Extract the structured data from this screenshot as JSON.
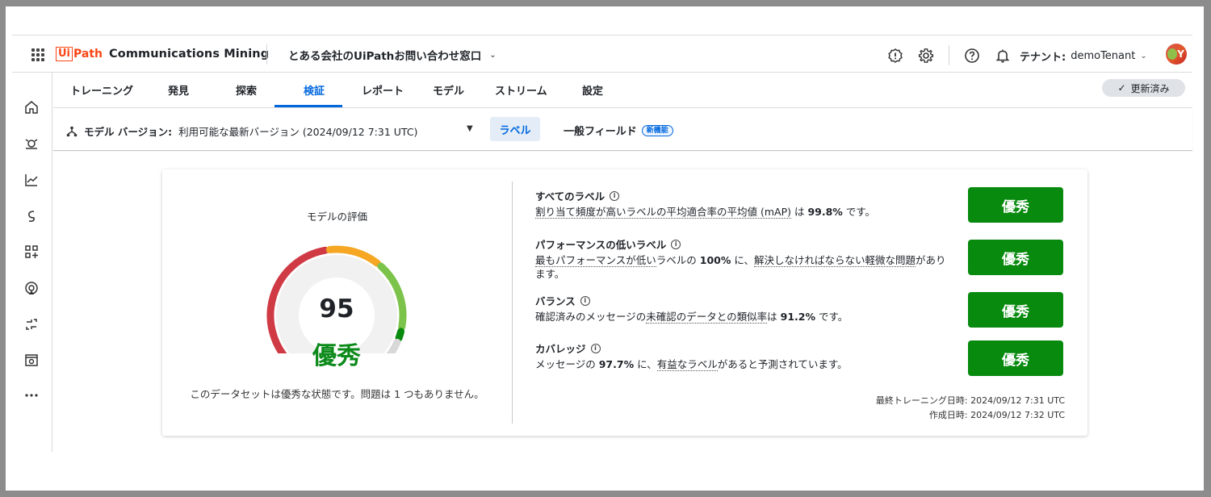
{
  "header": {
    "logo_ui": "Ui",
    "logo_path": "Path",
    "product": "Communications Mining",
    "project": "とある会社のUiPathお問い合わせ窓口",
    "tenant_label": "テナント:",
    "tenant_value": "demoTenant",
    "avatar_initial": "Y",
    "icons": [
      "apps-grid-icon",
      "alert-icon",
      "gear-icon",
      "help-icon",
      "bell-icon"
    ]
  },
  "tabs": [
    "トレーニング",
    "発見",
    "探索",
    "検証",
    "レポート",
    "モデル",
    "ストリーム",
    "設定"
  ],
  "active_tab": "検証",
  "refresh_label": "更新済み",
  "subbar": {
    "model_version_label": "モデル バージョン:",
    "model_version_value": "利用可能な最新バージョン (2024/09/12 7:31 UTC)",
    "labels_tab": "ラベル",
    "general_fields_tab": "一般フィールド",
    "new_badge": "新機能"
  },
  "rail_icons": [
    "home-icon",
    "discover-icon",
    "chart-icon",
    "stream-icon",
    "apps-add-icon",
    "signal-icon",
    "integration-icon",
    "building-icon",
    "more-icon"
  ],
  "rating": {
    "title": "モデルの評価",
    "score": "95",
    "score_value": 95,
    "grade": "優秀",
    "summary": "このデータセットは優秀な状態です。問題は 1 つもありません。",
    "colors": {
      "poor": "#d03a45",
      "ok": "#f5a623",
      "good": "#7bc34a",
      "excellent": "#078a0e",
      "track": "#d8d8d8"
    }
  },
  "metrics": [
    {
      "title": "すべてのラベル",
      "desc_pre": "",
      "desc_link": "割り当て頻度が高いラベルの平均適合率の平均値 (mAP)",
      "desc_mid": " は ",
      "desc_value": "99.8%",
      "desc_post": " です。",
      "grade": "優秀"
    },
    {
      "title": "パフォーマンスの低いラベル",
      "desc_pre": "",
      "desc_link": "最もパフォーマンスが低い",
      "desc_mid": "ラベルの ",
      "desc_value": "100%",
      "desc_post": " に、",
      "desc_link2": "解決しなければならない軽微な問題",
      "desc_post2": "があります。",
      "grade": "優秀"
    },
    {
      "title": "バランス",
      "desc_pre": "確認済みのメッセージの",
      "desc_link": "未確認のデータとの類似率",
      "desc_mid": "は ",
      "desc_value": "91.2%",
      "desc_post": " です。",
      "grade": "優秀"
    },
    {
      "title": "カバレッジ",
      "desc_pre": "メッセージの ",
      "desc_value_first": "97.7%",
      "desc_mid": " に、",
      "desc_link": "有益なラベル",
      "desc_post": "があると予測されています。",
      "grade": "優秀"
    }
  ],
  "dates": {
    "last_trained_label": "最終トレーニング日時:",
    "last_trained_value": "2024/09/12 7:31 UTC",
    "created_label": "作成日時:",
    "created_value": "2024/09/12 7:32 UTC"
  }
}
